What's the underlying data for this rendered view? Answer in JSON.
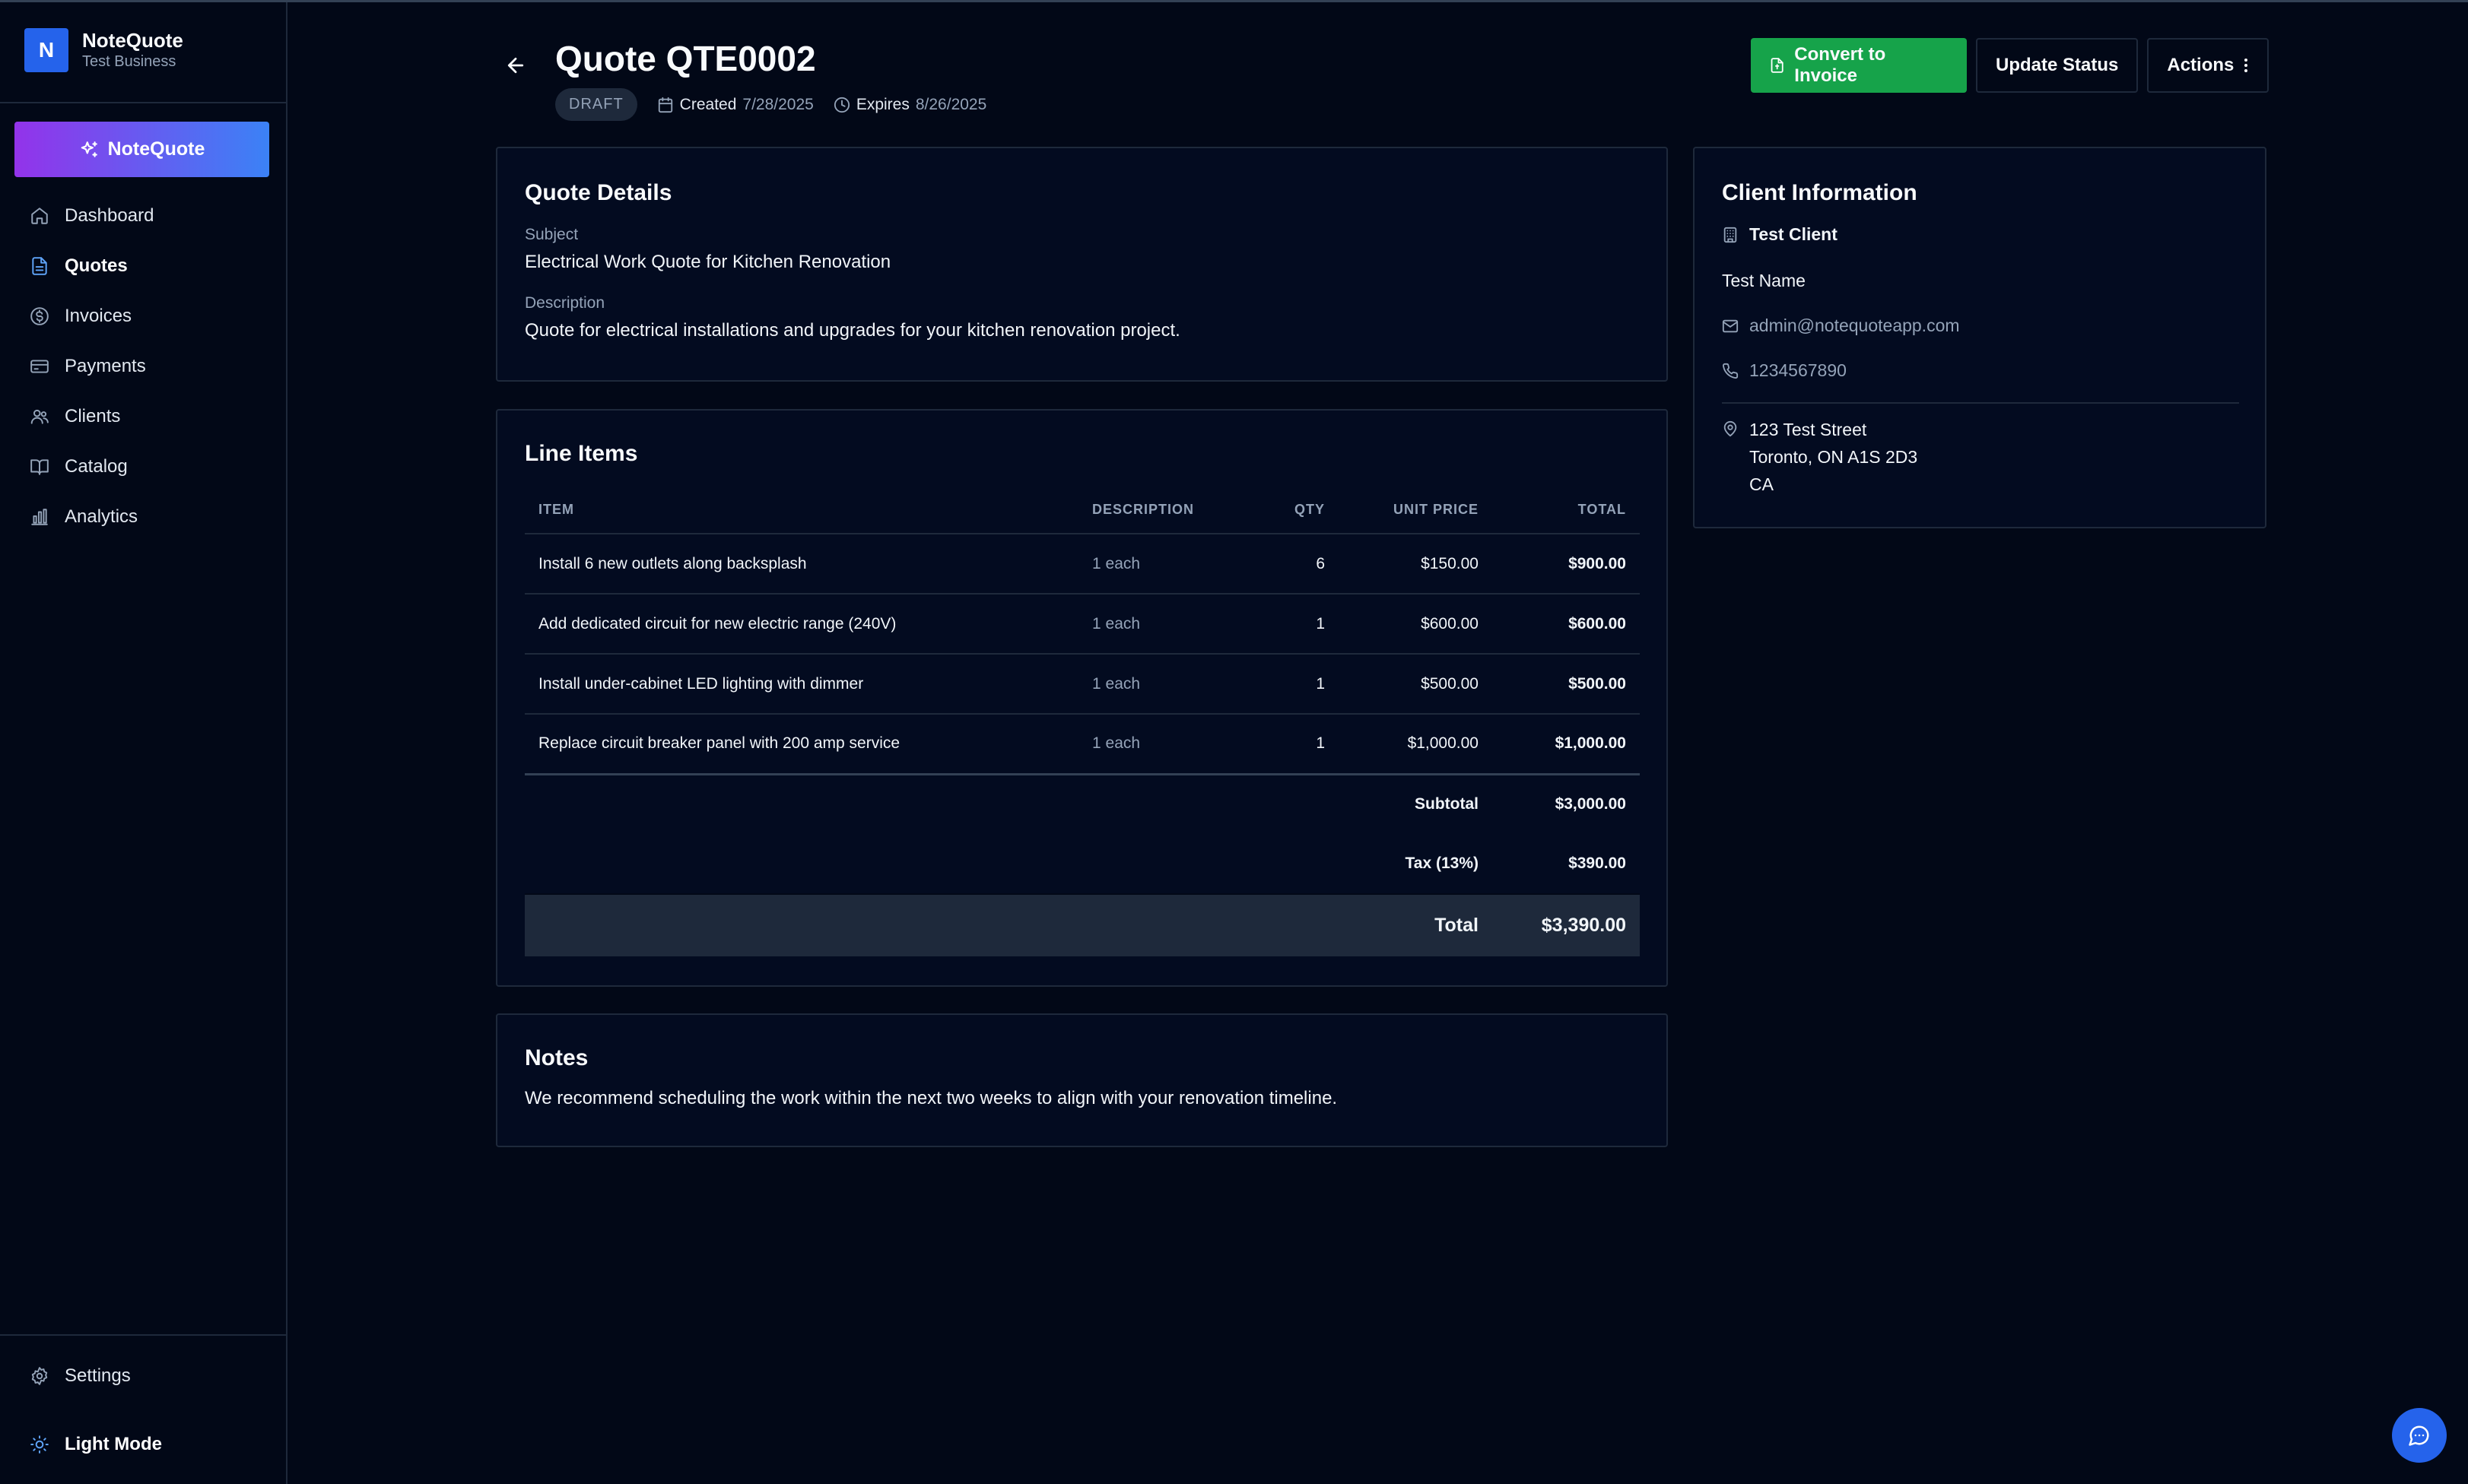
{
  "brand": {
    "initial": "N",
    "name": "NoteQuote",
    "subtitle": "Test Business"
  },
  "sidebar": {
    "cta_label": "NoteQuote",
    "items": [
      {
        "label": "Dashboard",
        "icon": "home-icon",
        "active": false
      },
      {
        "label": "Quotes",
        "icon": "file-icon",
        "active": true
      },
      {
        "label": "Invoices",
        "icon": "dollar-icon",
        "active": false
      },
      {
        "label": "Payments",
        "icon": "credit-card-icon",
        "active": false
      },
      {
        "label": "Clients",
        "icon": "users-icon",
        "active": false
      },
      {
        "label": "Catalog",
        "icon": "book-icon",
        "active": false
      },
      {
        "label": "Analytics",
        "icon": "bar-chart-icon",
        "active": false
      }
    ],
    "settings_label": "Settings",
    "theme_label": "Light Mode"
  },
  "header": {
    "title": "Quote QTE0002",
    "status": "DRAFT",
    "created_label": "Created",
    "created_date": "7/28/2025",
    "expires_label": "Expires",
    "expires_date": "8/26/2025",
    "convert_label": "Convert to Invoice",
    "update_label": "Update Status",
    "actions_label": "Actions"
  },
  "details": {
    "title": "Quote Details",
    "subject_label": "Subject",
    "subject": "Electrical Work Quote for Kitchen Renovation",
    "description_label": "Description",
    "description": "Quote for electrical installations and upgrades for your kitchen renovation project."
  },
  "line_items": {
    "title": "Line Items",
    "columns": [
      "ITEM",
      "DESCRIPTION",
      "QTY",
      "UNIT PRICE",
      "TOTAL"
    ],
    "rows": [
      {
        "item": "Install 6 new outlets along backsplash",
        "description": "1 each",
        "qty": "6",
        "unit_price": "$150.00",
        "total": "$900.00"
      },
      {
        "item": "Add dedicated circuit for new electric range (240V)",
        "description": "1 each",
        "qty": "1",
        "unit_price": "$600.00",
        "total": "$600.00"
      },
      {
        "item": "Install under-cabinet LED lighting with dimmer",
        "description": "1 each",
        "qty": "1",
        "unit_price": "$500.00",
        "total": "$500.00"
      },
      {
        "item": "Replace circuit breaker panel with 200 amp service",
        "description": "1 each",
        "qty": "1",
        "unit_price": "$1,000.00",
        "total": "$1,000.00"
      }
    ],
    "subtotal_label": "Subtotal",
    "subtotal": "$3,000.00",
    "tax_label": "Tax (13%)",
    "tax": "$390.00",
    "total_label": "Total",
    "total": "$3,390.00"
  },
  "notes": {
    "title": "Notes",
    "text": "We recommend scheduling the work within the next two weeks to align with your renovation timeline."
  },
  "client": {
    "title": "Client Information",
    "company": "Test Client",
    "contact": "Test Name",
    "email": "admin@notequoteapp.com",
    "phone": "1234567890",
    "address_line1": "123 Test Street",
    "address_line2": "Toronto, ON A1S 2D3",
    "address_line3": "CA"
  },
  "colors": {
    "accent": "#2563eb",
    "success": "#16a34a",
    "background": "#020817",
    "card": "#030b20",
    "border": "#1e293b"
  }
}
